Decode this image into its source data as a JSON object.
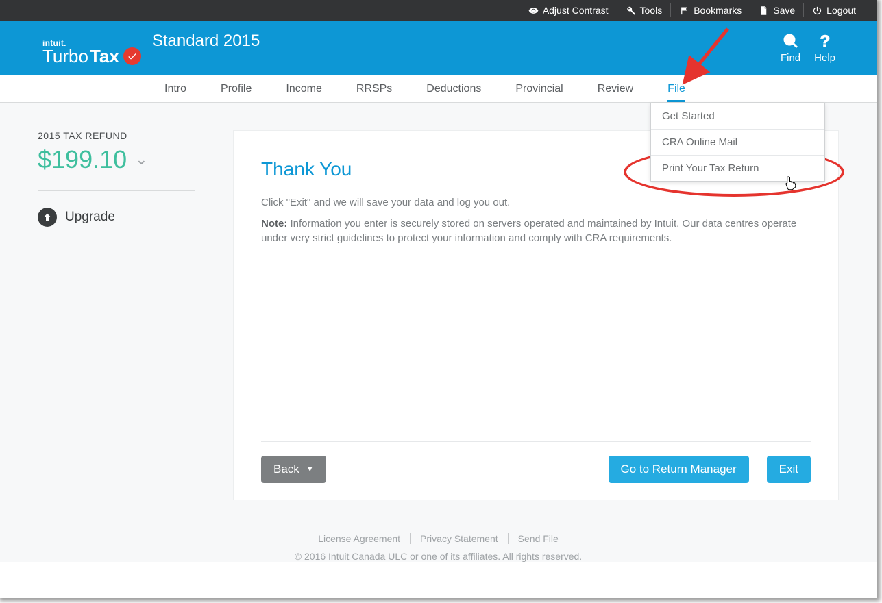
{
  "topbar": {
    "adjust_contrast": "Adjust Contrast",
    "tools": "Tools",
    "bookmarks": "Bookmarks",
    "save": "Save",
    "logout": "Logout"
  },
  "brand": {
    "intuit": "intuit.",
    "name_part1": "Turbo",
    "name_part2": "Tax",
    "edition": "Standard 2015"
  },
  "header_actions": {
    "find": "Find",
    "help": "Help"
  },
  "nav": {
    "items": [
      "Intro",
      "Profile",
      "Income",
      "RRSPs",
      "Deductions",
      "Provincial",
      "Review",
      "File"
    ],
    "active_index": 7
  },
  "dropdown": {
    "items": [
      "Get Started",
      "CRA Online Mail",
      "Print Your Tax Return"
    ]
  },
  "sidebar": {
    "refund_label": "2015 TAX REFUND",
    "refund_amount": "$199.10",
    "upgrade": "Upgrade"
  },
  "card": {
    "title": "Thank You",
    "text1": "Click \"Exit\" and we will save your data and log you out.",
    "note_label": "Note:",
    "note_text": " Information you enter is securely stored on servers operated and maintained by Intuit. Our data centres operate under very strict guidelines to protect your information and comply with CRA requirements.",
    "back": "Back",
    "goto": "Go to Return Manager",
    "exit": "Exit"
  },
  "footer": {
    "links": [
      "License Agreement",
      "Privacy Statement",
      "Send File"
    ],
    "copyright": "© 2016 Intuit Canada ULC or one of its affiliates. All rights reserved."
  }
}
